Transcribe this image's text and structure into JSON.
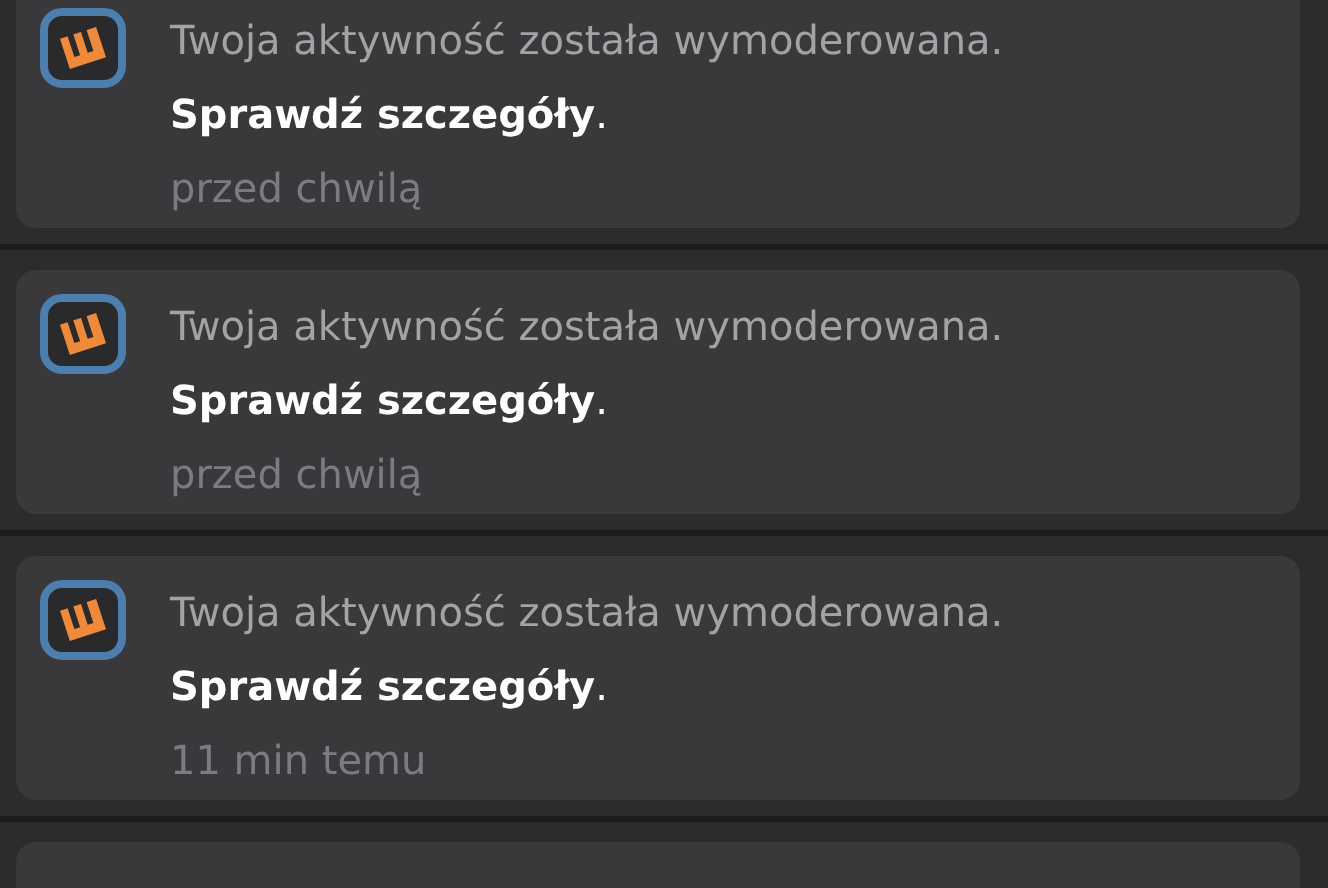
{
  "notifications": [
    {
      "message": "Twoja aktywność została wymoderowana.",
      "action": "**Sprawdź szczegóły**.",
      "time": "przed chwilą"
    },
    {
      "message": "Twoja aktywność została wymoderowana.",
      "action": "**Sprawdź szczegóły**.",
      "time": "przed chwilą"
    },
    {
      "message": "Twoja aktywność została wymoderowana.",
      "action": "**Sprawdź szczegóły**.",
      "time": "11 min temu"
    }
  ]
}
